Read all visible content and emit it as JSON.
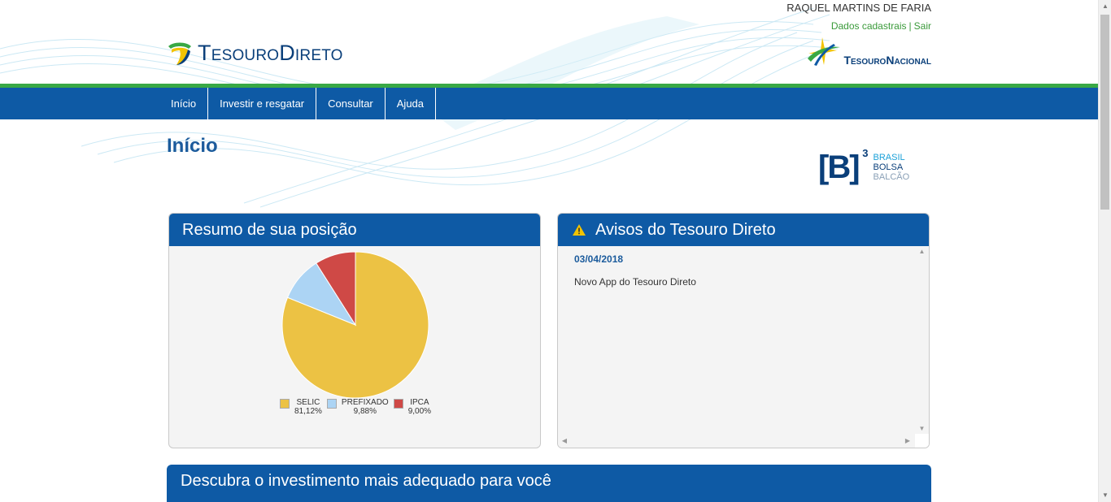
{
  "brand": {
    "logo_text": "TesouroDireto",
    "partner_logo_text": "TesouroNacional"
  },
  "user": {
    "name": "RAQUEL MARTINS DE FARIA",
    "profile_link": "Dados cadastrais",
    "separator": "|",
    "logout_link": "Sair"
  },
  "nav": {
    "items": [
      {
        "label": "Início"
      },
      {
        "label": "Investir e resgatar"
      },
      {
        "label": "Consultar"
      },
      {
        "label": "Ajuda"
      }
    ]
  },
  "page": {
    "title": "Início"
  },
  "b3_logo": {
    "mark": "[B]",
    "superscript": "3",
    "line1": "BRASIL",
    "line2": "BOLSA",
    "line3": "BALCÃO"
  },
  "position_panel": {
    "title": "Resumo de sua posição"
  },
  "chart_data": {
    "type": "pie",
    "slices": [
      {
        "label": "SELIC",
        "value": 81.12,
        "display": "81,12%",
        "color": "#ecc244"
      },
      {
        "label": "PREFIXADO",
        "value": 9.88,
        "display": "9,88%",
        "color": "#acd4f4"
      },
      {
        "label": "IPCA",
        "value": 9.0,
        "display": "9,00%",
        "color": "#cf4946"
      }
    ],
    "legend_position": "bottom"
  },
  "notices_panel": {
    "title": "Avisos do Tesouro Direto",
    "icon": "warning-icon",
    "items": [
      {
        "date": "03/04/2018",
        "text": "Novo App do Tesouro Direto"
      }
    ]
  },
  "discover_panel": {
    "title": "Descubra o investimento mais adequado para você"
  },
  "colors": {
    "primary_blue": "#0e5aa5",
    "accent_green": "#39a845",
    "title_blue": "#1b5b9c"
  }
}
